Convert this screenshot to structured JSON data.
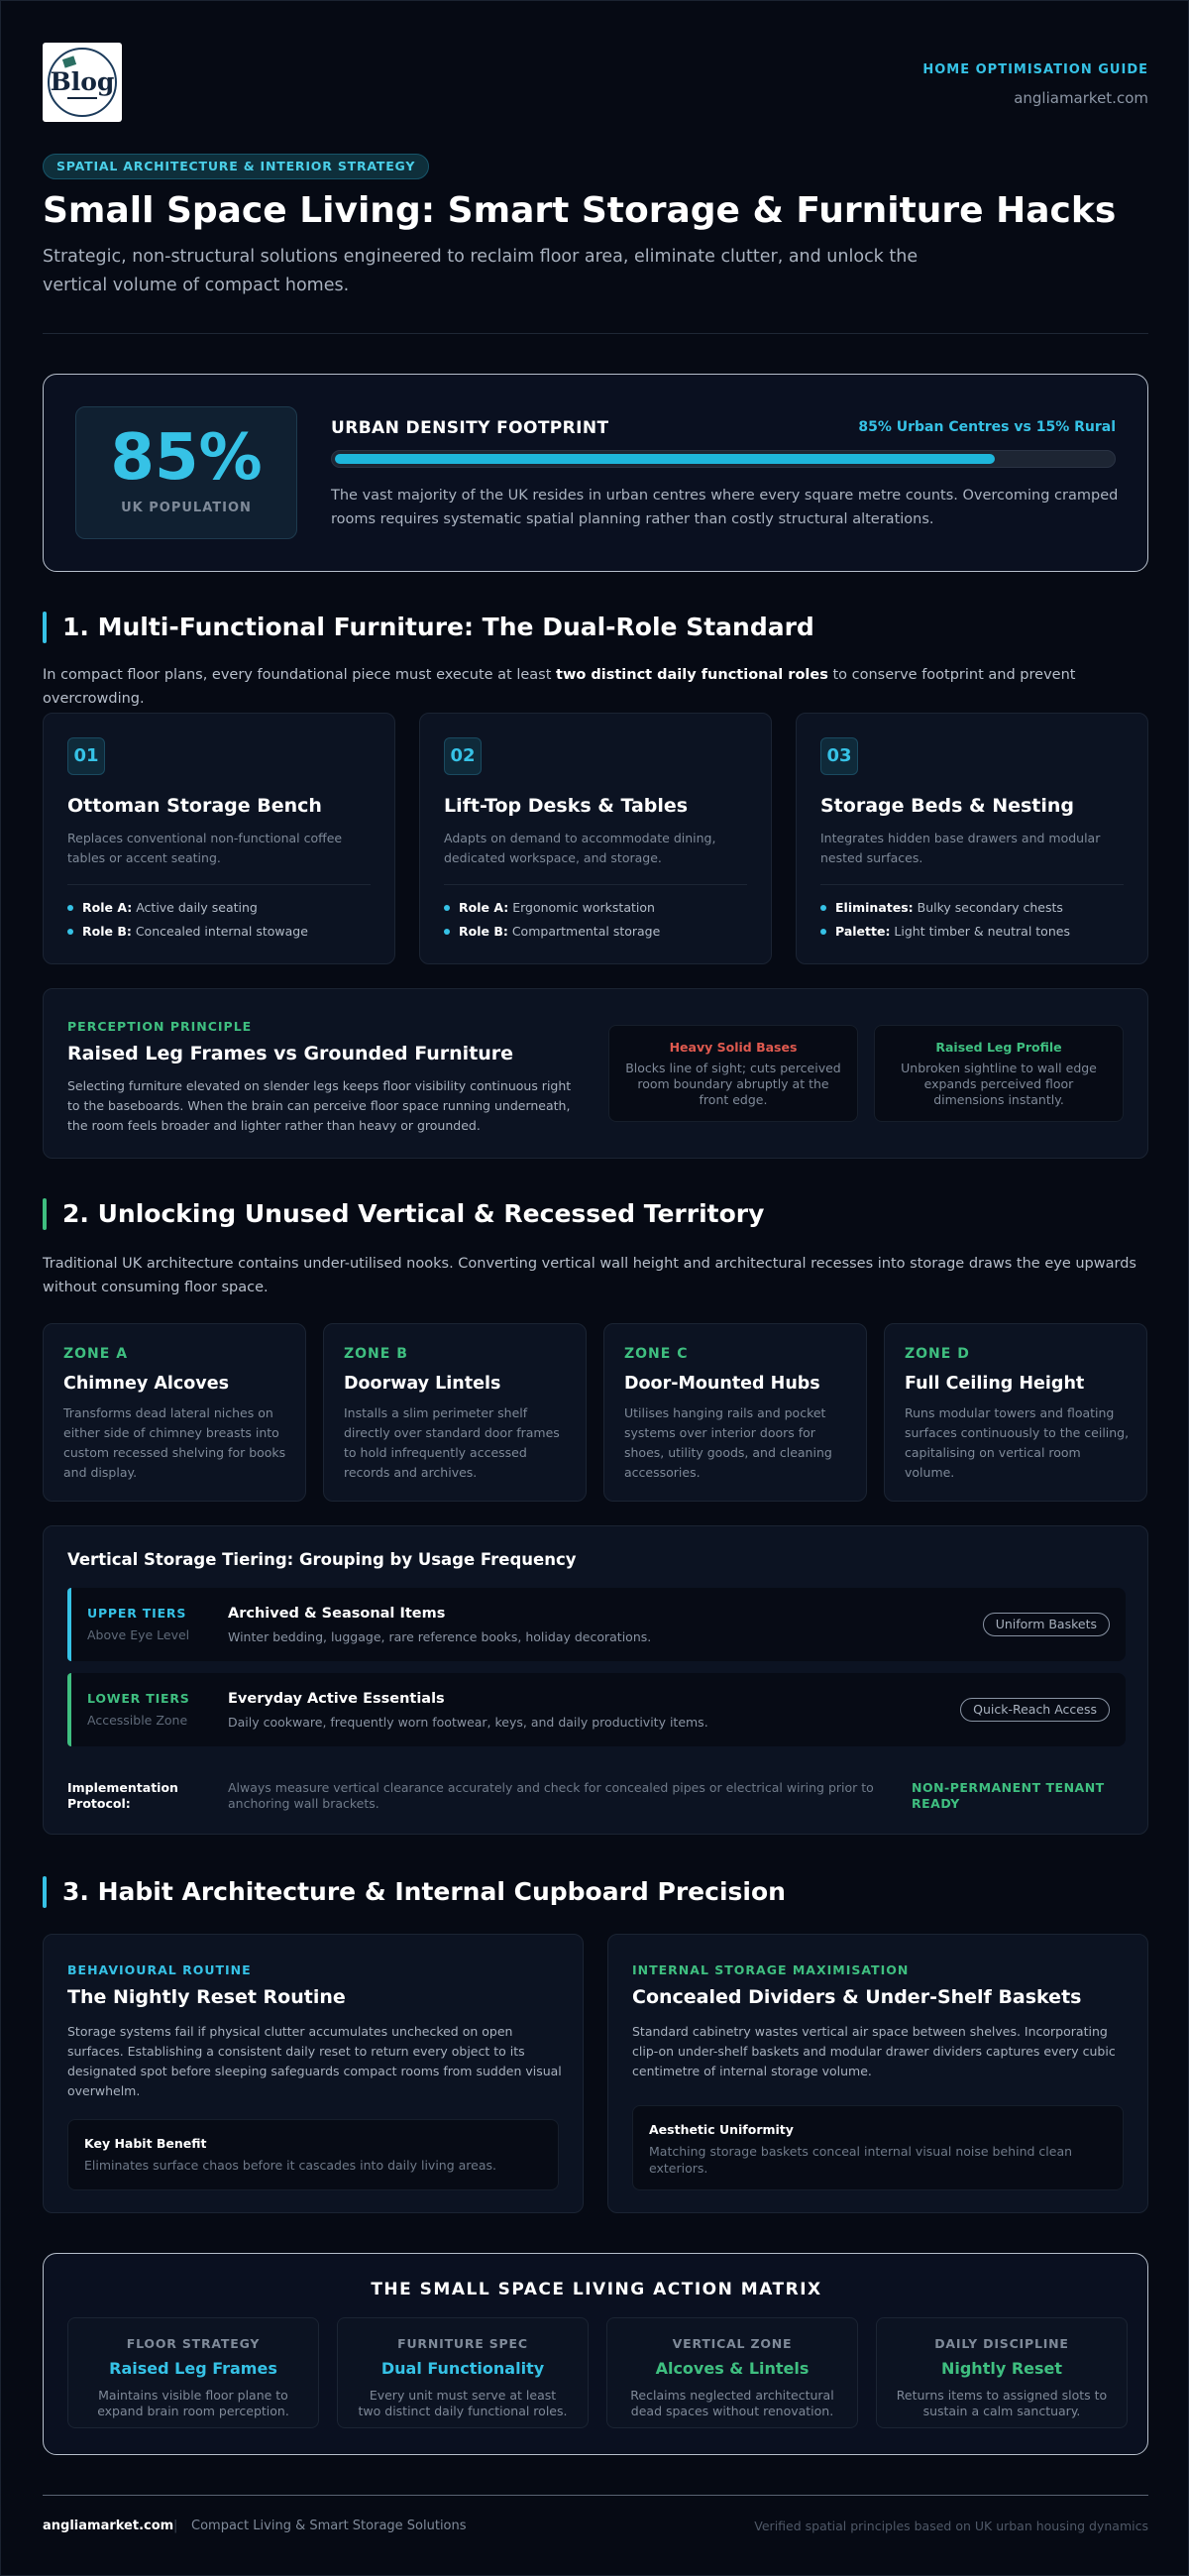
{
  "header": {
    "logo_text": "Blog",
    "guide_label": "HOME OPTIMISATION GUIDE",
    "site": "angliamarket.com"
  },
  "hero": {
    "category": "SPATIAL ARCHITECTURE & INTERIOR STRATEGY",
    "title": "Small Space Living: Smart Storage & Furniture Hacks",
    "lead": "Strategic, non-structural solutions engineered to reclaim floor area, eliminate clutter, and unlock the vertical volume of compact homes."
  },
  "stat": {
    "value": "85%",
    "label": "UK POPULATION",
    "title": "URBAN DENSITY FOOTPRINT",
    "comparison": "85% Urban Centres vs 15% Rural",
    "urban_fraction": 0.85,
    "description": "The vast majority of the UK resides in urban centres where every square metre counts. Overcoming cramped rooms requires systematic spatial planning rather than costly structural alterations."
  },
  "section1": {
    "title": "1. Multi-Functional Furniture: The Dual-Role Standard",
    "lead_pre": "In compact floor plans, every foundational piece must execute at least ",
    "lead_bold": "two distinct daily functional roles",
    "lead_post": " to conserve footprint and prevent overcrowding.",
    "cards": [
      {
        "num": "01",
        "title": "Ottoman Storage Bench",
        "desc": "Replaces conventional non-functional coffee tables or accent seating.",
        "items": [
          {
            "k": "Role A:",
            "v": " Active daily seating"
          },
          {
            "k": "Role B:",
            "v": " Concealed internal stowage"
          }
        ]
      },
      {
        "num": "02",
        "title": "Lift-Top Desks & Tables",
        "desc": "Adapts on demand to accommodate dining, dedicated workspace, and storage.",
        "items": [
          {
            "k": "Role A:",
            "v": " Ergonomic workstation"
          },
          {
            "k": "Role B:",
            "v": " Compartmental storage"
          }
        ]
      },
      {
        "num": "03",
        "title": "Storage Beds & Nesting",
        "desc": "Integrates hidden base drawers and modular nested surfaces.",
        "items": [
          {
            "k": "Eliminates:",
            "v": " Bulky secondary chests"
          },
          {
            "k": "Palette:",
            "v": " Light timber & neutral tones"
          }
        ]
      }
    ],
    "perception": {
      "eyebrow": "PERCEPTION PRINCIPLE",
      "title": "Raised Leg Frames vs Grounded Furniture",
      "desc": "Selecting furniture elevated on slender legs keeps floor visibility continuous right to the baseboards. When the brain can perceive floor space running underneath, the room feels broader and lighter rather than heavy or grounded.",
      "heavy_title": "Heavy Solid Bases",
      "heavy_desc": "Blocks line of sight; cuts perceived room boundary abruptly at the front edge.",
      "raised_title": "Raised Leg Profile",
      "raised_desc": "Unbroken sightline to wall edge expands perceived floor dimensions instantly."
    }
  },
  "section2": {
    "title": "2. Unlocking Unused Vertical & Recessed Territory",
    "lead": "Traditional UK architecture contains under-utilised nooks. Converting vertical wall height and architectural recesses into storage draws the eye upwards without consuming floor space.",
    "zones": [
      {
        "label": "ZONE A",
        "title": "Chimney Alcoves",
        "desc": "Transforms dead lateral niches on either side of chimney breasts into custom recessed shelving for books and display."
      },
      {
        "label": "ZONE B",
        "title": "Doorway Lintels",
        "desc": "Installs a slim perimeter shelf directly over standard door frames to hold infrequently accessed records and archives."
      },
      {
        "label": "ZONE C",
        "title": "Door-Mounted Hubs",
        "desc": "Utilises hanging rails and pocket systems over interior doors for shoes, utility goods, and cleaning accessories."
      },
      {
        "label": "ZONE D",
        "title": "Full Ceiling Height",
        "desc": "Runs modular towers and floating surfaces continuously to the ceiling, capitalising on vertical room volume."
      }
    ],
    "tiering": {
      "title": "Vertical Storage Tiering: Grouping by Usage Frequency",
      "upper": {
        "tier": "UPPER TIERS",
        "sub": "Above Eye Level",
        "title": "Archived & Seasonal Items",
        "desc": "Winter bedding, luggage, rare reference books, holiday decorations.",
        "tag": "Uniform Baskets"
      },
      "lower": {
        "tier": "LOWER TIERS",
        "sub": "Accessible Zone",
        "title": "Everyday Active Essentials",
        "desc": "Daily cookware, frequently worn footwear, keys, and daily productivity items.",
        "tag": "Quick-Reach Access"
      },
      "impl_label": "Implementation Protocol:",
      "impl_desc": "Always measure vertical clearance accurately and check for concealed pipes or electrical wiring prior to anchoring wall brackets.",
      "impl_right": "NON-PERMANENT TENANT READY"
    }
  },
  "section3": {
    "title": "3. Habit Architecture & Internal Cupboard Precision",
    "left": {
      "eyebrow": "BEHAVIOURAL ROUTINE",
      "title": "The Nightly Reset Routine",
      "desc": "Storage systems fail if physical clutter accumulates unchecked on open surfaces. Establishing a consistent daily reset to return every object to its designated spot before sleeping safeguards compact rooms from sudden visual overwhelm.",
      "box_title": "Key Habit Benefit",
      "box_desc": "Eliminates surface chaos before it cascades into daily living areas."
    },
    "right": {
      "eyebrow": "INTERNAL STORAGE MAXIMISATION",
      "title": "Concealed Dividers & Under-Shelf Baskets",
      "desc": "Standard cabinetry wastes vertical air space between shelves. Incorporating clip-on under-shelf baskets and modular drawer dividers captures every cubic centimetre of internal storage volume.",
      "box_title": "Aesthetic Uniformity",
      "box_desc": "Matching storage baskets conceal internal visual noise behind clean exteriors."
    }
  },
  "matrix": {
    "title": "THE SMALL SPACE LIVING ACTION MATRIX",
    "items": [
      {
        "head": "FLOOR STRATEGY",
        "value": "Raised Leg Frames",
        "desc": "Maintains visible floor plane to expand brain room perception."
      },
      {
        "head": "FURNITURE SPEC",
        "value": "Dual Functionality",
        "desc": "Every unit must serve at least two distinct daily functional roles."
      },
      {
        "head": "VERTICAL ZONE",
        "value": "Alcoves & Lintels",
        "desc": "Reclaims neglected architectural dead spaces without renovation."
      },
      {
        "head": "DAILY DISCIPLINE",
        "value": "Nightly Reset",
        "desc": "Returns items to assigned slots to sustain a calm sanctuary."
      }
    ]
  },
  "footer": {
    "brand": "angliamarket.com",
    "sep": "|",
    "tagline": "Compact Living & Smart Storage Solutions",
    "right": "Verified spatial principles based on UK urban housing dynamics"
  },
  "colors": {
    "accent_cyan": "#36c2e6",
    "accent_green": "#3fbf80",
    "warning_red": "#e05a4f",
    "background": "#060a14"
  }
}
